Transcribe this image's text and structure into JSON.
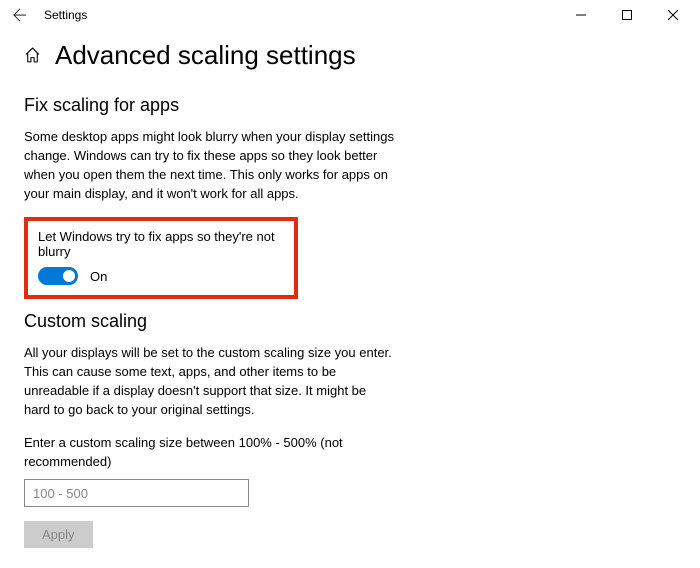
{
  "titlebar": {
    "title": "Settings"
  },
  "page": {
    "title": "Advanced scaling settings"
  },
  "fix_scaling": {
    "heading": "Fix scaling for apps",
    "description": "Some desktop apps might look blurry when your display settings change. Windows can try to fix these apps so they look better when you open them the next time. This only works for apps on your main display, and it won't work for all apps.",
    "toggle_label": "Let Windows try to fix apps so they're not blurry",
    "toggle_state": "On"
  },
  "custom_scaling": {
    "heading": "Custom scaling",
    "description": "All your displays will be set to the custom scaling size you enter. This can cause some text, apps, and other items to be unreadable if a display doesn't support that size. It might be hard to go back to your original settings.",
    "input_label": "Enter a custom scaling size between 100% - 500% (not recommended)",
    "placeholder": "100 - 500",
    "apply_label": "Apply"
  }
}
